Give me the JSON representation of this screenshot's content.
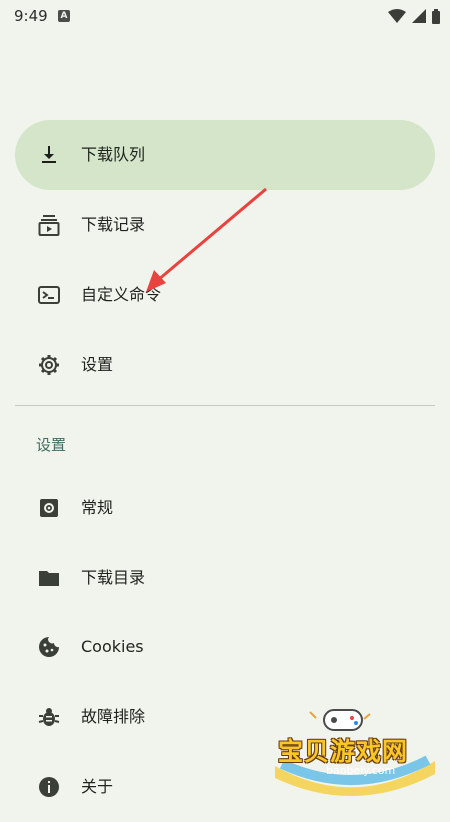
{
  "status_bar": {
    "time": "9:49",
    "notification_letter": "A"
  },
  "nav": {
    "items": [
      {
        "label": "下载队列",
        "icon": "download-icon",
        "active": true
      },
      {
        "label": "下载记录",
        "icon": "history-icon",
        "active": false
      },
      {
        "label": "自定义命令",
        "icon": "terminal-icon",
        "active": false
      },
      {
        "label": "设置",
        "icon": "gear-icon",
        "active": false
      }
    ]
  },
  "settings_section": {
    "title": "设置",
    "items": [
      {
        "label": "常规",
        "icon": "general-settings-icon"
      },
      {
        "label": "下载目录",
        "icon": "folder-icon"
      },
      {
        "label": "Cookies",
        "icon": "cookie-icon"
      },
      {
        "label": "故障排除",
        "icon": "bug-icon"
      },
      {
        "label": "关于",
        "icon": "info-icon"
      }
    ]
  },
  "watermark": {
    "brand": "宝贝游戏网",
    "url": "baobeiy.com"
  },
  "colors": {
    "background": "#f1f4ec",
    "active_pill": "#d4e5c9",
    "section_title": "#3f6c63",
    "annotation_arrow": "#e8433f"
  }
}
